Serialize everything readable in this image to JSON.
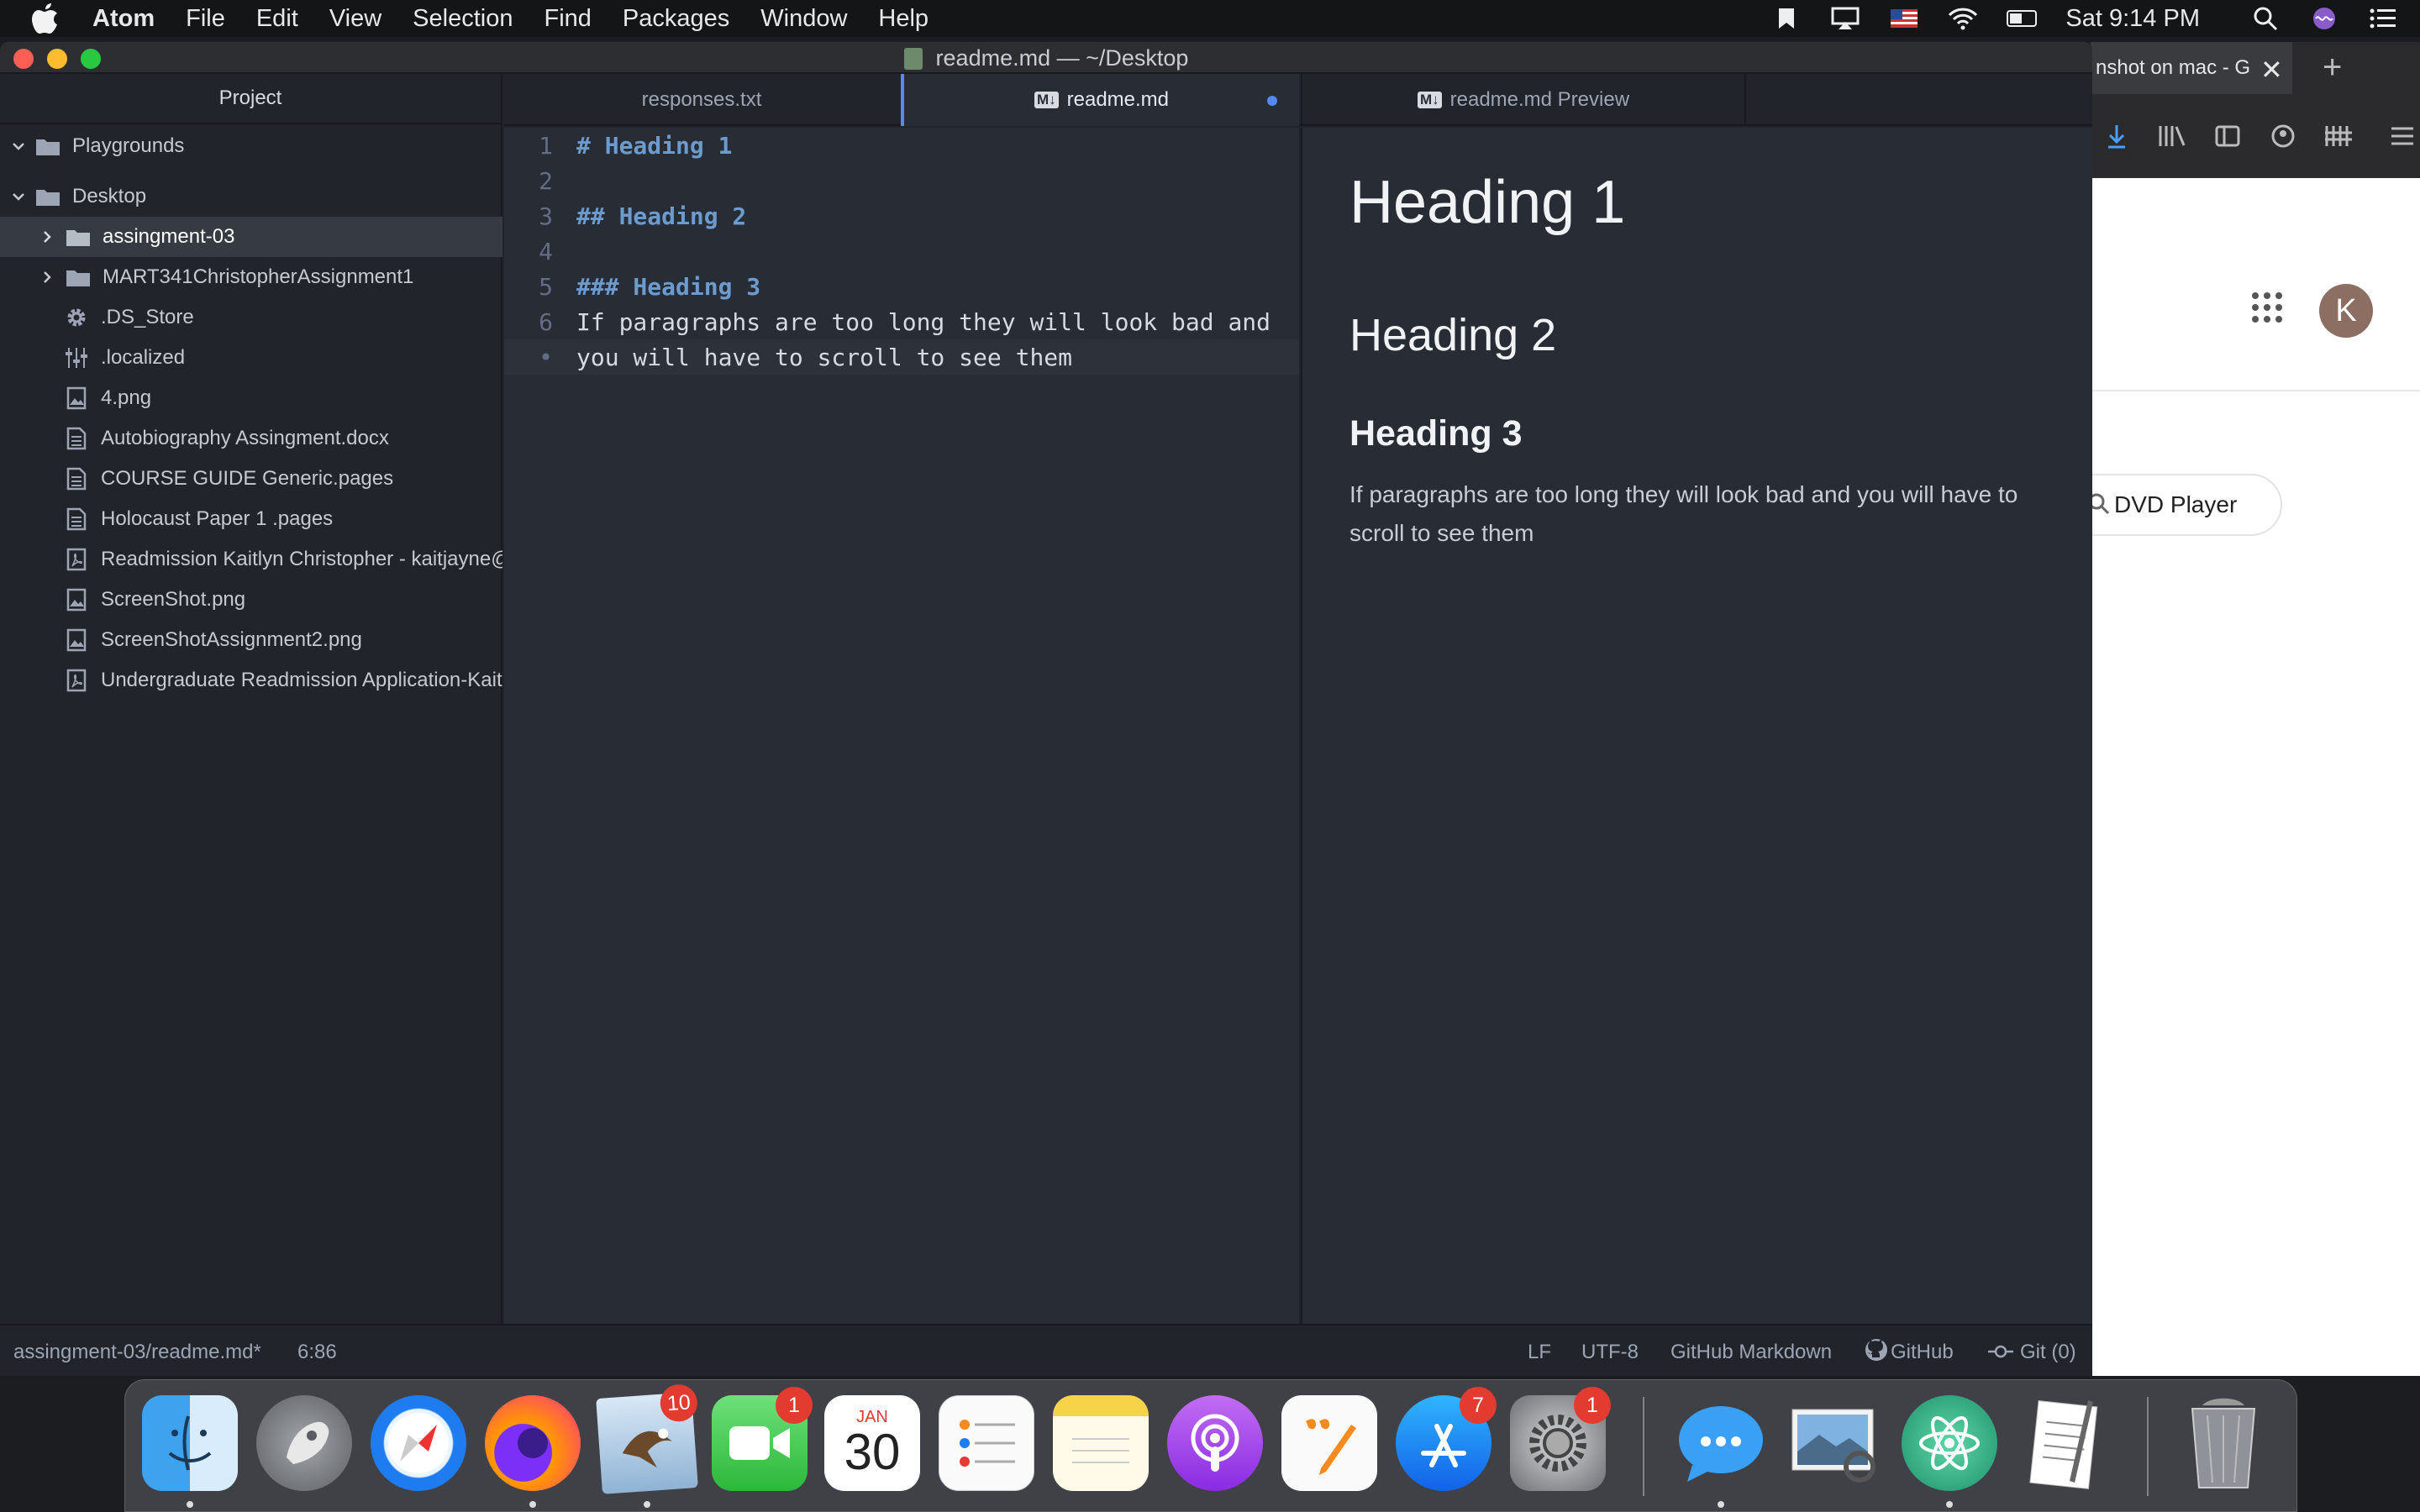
{
  "menubar": {
    "app_name": "Atom",
    "items": [
      "File",
      "Edit",
      "View",
      "Selection",
      "Find",
      "Packages",
      "Window",
      "Help"
    ],
    "clock": "Sat 9:14 PM",
    "status_icons": [
      "bookmark-icon",
      "airplay-icon",
      "us-flag-icon",
      "wifi-icon",
      "battery-icon",
      "spotlight-search-icon",
      "siri-icon",
      "notification-center-icon"
    ]
  },
  "window": {
    "title": "readme.md — ~/Desktop"
  },
  "tree": {
    "header": "Project",
    "roots": [
      {
        "label": "Playgrounds"
      },
      {
        "label": "Desktop"
      }
    ],
    "items": [
      {
        "label": "assingment-03",
        "icon": "folder-icon",
        "selected": true
      },
      {
        "label": "MART341ChristopherAssignment1",
        "icon": "folder-icon"
      },
      {
        "label": ".DS_Store",
        "icon": "gear-icon"
      },
      {
        "label": ".localized",
        "icon": "sliders-icon"
      },
      {
        "label": "4.png",
        "icon": "image-file-icon"
      },
      {
        "label": "Autobiography Assingment.docx",
        "icon": "text-file-icon"
      },
      {
        "label": "COURSE GUIDE Generic.pages",
        "icon": "text-file-icon"
      },
      {
        "label": "Holocaust Paper 1 .pages",
        "icon": "text-file-icon"
      },
      {
        "label": "Readmission Kaitlyn Christopher - kaitjayne@",
        "icon": "pdf-file-icon"
      },
      {
        "label": "ScreenShot.png",
        "icon": "image-file-icon"
      },
      {
        "label": "ScreenShotAssignment2.png",
        "icon": "image-file-icon"
      },
      {
        "label": "Undergraduate Readmission Application-Kait",
        "icon": "pdf-file-icon"
      }
    ]
  },
  "tabs": [
    {
      "label": "responses.txt"
    },
    {
      "label": "readme.md",
      "modified": true
    },
    {
      "label": "readme.md Preview"
    }
  ],
  "tab_md_badge": "M↓",
  "editor": {
    "lines": [
      {
        "num": "1",
        "text": "# Heading 1"
      },
      {
        "num": "2",
        "text": ""
      },
      {
        "num": "3",
        "text": "## Heading 2"
      },
      {
        "num": "4",
        "text": ""
      },
      {
        "num": "5",
        "text": "### Heading 3"
      },
      {
        "num": "6",
        "text": "If paragraphs are too long they will look bad and"
      },
      {
        "num": "•",
        "text": "you will have to scroll to see them"
      }
    ]
  },
  "preview": {
    "h1": "Heading 1",
    "h2": "Heading 2",
    "h3": "Heading 3",
    "paragraph": "If paragraphs are too long they will look bad and you will have to scroll to see them"
  },
  "status": {
    "file": "assingment-03/readme.md*",
    "cursor": "6:86",
    "line_ending": "LF",
    "encoding": "UTF-8",
    "grammar": "GitHub Markdown",
    "github": "GitHub",
    "git": "Git (0)"
  },
  "browser": {
    "tab_title": "nshot on mac - G",
    "avatar_letter": "K",
    "search_chip": "DVD Player"
  },
  "dock": {
    "apps": [
      {
        "name": "Finder",
        "badge": null,
        "running": true
      },
      {
        "name": "Launchpad",
        "badge": null,
        "running": false
      },
      {
        "name": "Safari",
        "badge": null,
        "running": false
      },
      {
        "name": "Firefox",
        "badge": null,
        "running": true
      },
      {
        "name": "Mail",
        "badge": "10",
        "running": true
      },
      {
        "name": "FaceTime",
        "badge": "1",
        "running": false
      },
      {
        "name": "Calendar",
        "badge": null,
        "running": false,
        "month": "JAN",
        "day": "30"
      },
      {
        "name": "Reminders",
        "badge": null,
        "running": false
      },
      {
        "name": "Notes",
        "badge": null,
        "running": false
      },
      {
        "name": "Podcasts",
        "badge": null,
        "running": false
      },
      {
        "name": "Pages",
        "badge": null,
        "running": false
      },
      {
        "name": "App Store",
        "badge": "7",
        "running": false
      },
      {
        "name": "System Preferences",
        "badge": "1",
        "running": false
      },
      {
        "name": "Messages",
        "badge": null,
        "running": true
      },
      {
        "name": "Preview",
        "badge": null,
        "running": false
      },
      {
        "name": "Atom",
        "badge": null,
        "running": true
      },
      {
        "name": "TextEdit",
        "badge": null,
        "running": false
      },
      {
        "name": "Trash",
        "badge": null,
        "running": false
      }
    ]
  },
  "colors": {
    "accent": "#568af2",
    "editor_bg": "#282c34",
    "panel_bg": "#21252b",
    "heading_syntax": "#6c9bd0"
  }
}
